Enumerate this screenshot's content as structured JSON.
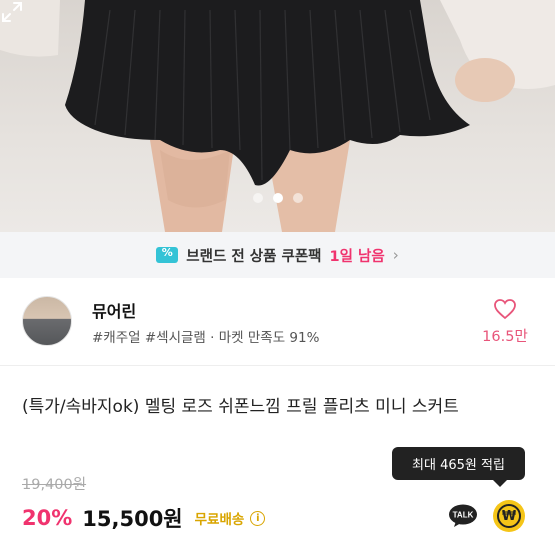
{
  "gallery": {
    "slide_count": 3,
    "active_slide": 2
  },
  "banner": {
    "text": "브랜드 전 상품 쿠폰팩",
    "highlight": "1일 남음",
    "chevron": "›"
  },
  "seller": {
    "name": "뮤어린",
    "tags": "#캐주얼 #섹시글램 · 마켓 만족도 91%",
    "likes": "16.5만"
  },
  "product": {
    "title": "(특가/속바지ok) 멜팅 로즈 쉬폰느낌 프릴 플리츠 미니 스커트",
    "original_price": "19,400원",
    "discount": "20%",
    "price": "15,500원",
    "shipping": "무료배송"
  },
  "tooltip": {
    "text": "최대 465원 적립"
  },
  "actions": {
    "talk_label": "TALK",
    "point_symbol": "₩"
  },
  "colors": {
    "accent_pink": "#f0336e",
    "shipping_gold": "#d9a500",
    "coupon_teal": "#34c3d6",
    "point_yellow": "#f5c518"
  }
}
